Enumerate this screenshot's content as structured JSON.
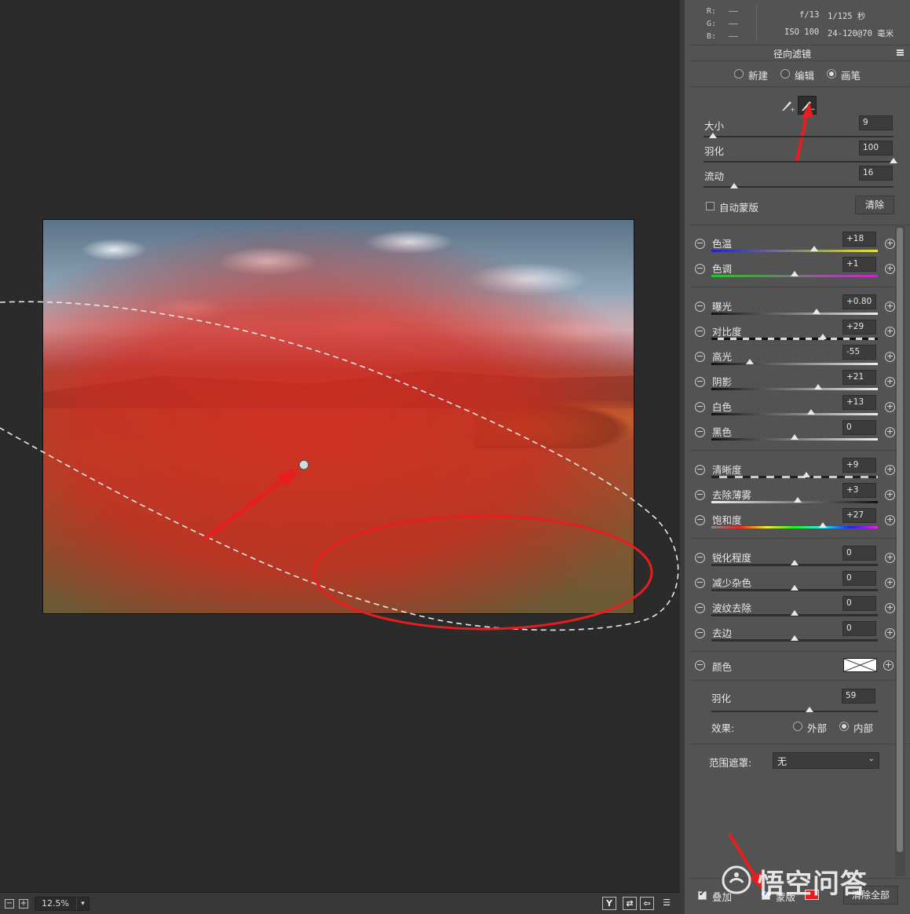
{
  "info": {
    "rgb_labels": [
      "R:",
      "G:",
      "B:"
    ],
    "rgb_values": [
      "——",
      "——",
      "——"
    ],
    "aperture": "f/13",
    "shutter": "1/125 秒",
    "iso": "ISO 100",
    "lens": "24-120@70 毫米"
  },
  "panel_title": "径向滤镜",
  "modes": [
    {
      "label": "新建",
      "selected": false
    },
    {
      "label": "编辑",
      "selected": false
    },
    {
      "label": "画笔",
      "selected": true
    }
  ],
  "brush": {
    "size": {
      "label": "大小",
      "value": "9",
      "level": 0.05
    },
    "feather": {
      "label": "羽化",
      "value": "100",
      "level": 1.0
    },
    "flow": {
      "label": "流动",
      "value": "16",
      "level": 0.16
    },
    "auto_mask": {
      "label": "自动蒙版",
      "checked": false
    },
    "clear": "清除"
  },
  "adjustments": [
    {
      "label": "色温",
      "value": "+18"
    },
    {
      "label": "色调",
      "value": "+1"
    },
    {
      "label": "曝光",
      "value": "+0.80"
    },
    {
      "label": "对比度",
      "value": "+29"
    },
    {
      "label": "高光",
      "value": "-55"
    },
    {
      "label": "阴影",
      "value": "+21"
    },
    {
      "label": "白色",
      "value": "+13"
    },
    {
      "label": "黑色",
      "value": "0"
    },
    {
      "label": "清晰度",
      "value": "+9"
    },
    {
      "label": "去除薄雾",
      "value": "+3"
    },
    {
      "label": "饱和度",
      "value": "+27"
    },
    {
      "label": "锐化程度",
      "value": "0"
    },
    {
      "label": "减少杂色",
      "value": "0"
    },
    {
      "label": "波纹去除",
      "value": "0"
    },
    {
      "label": "去边",
      "value": "0"
    }
  ],
  "color": {
    "label": "颜色"
  },
  "feather2": {
    "label": "羽化",
    "value": "59",
    "level": 0.59
  },
  "effect": {
    "label": "效果:",
    "outside": "外部",
    "inside": "内部",
    "selected": "内部"
  },
  "range_mask": {
    "label": "范围遮罩:",
    "value": "无"
  },
  "footer": {
    "overlay": "叠加",
    "mask": "蒙版",
    "clear_all": "清除全部",
    "mask_color": "#e02020"
  },
  "statusbar": {
    "zoom": "12.5%",
    "minus": "−",
    "plus": "+",
    "view_y": "Y"
  },
  "watermark": "悟空问答",
  "colors": {
    "annotation_red": "#e81e1e",
    "mask_overlay": "#d8281e",
    "panel_bg": "#535353",
    "canvas_bg": "#2b2b2b"
  }
}
